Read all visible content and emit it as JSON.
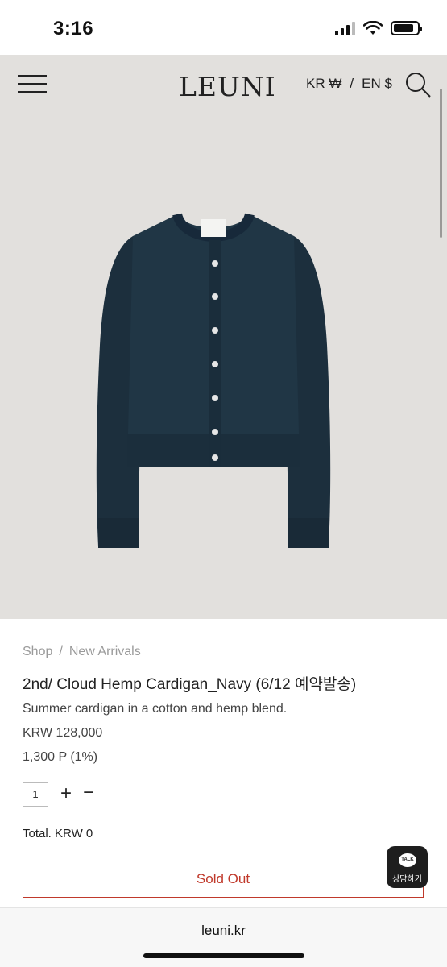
{
  "status": {
    "time": "3:16",
    "battery_level": 0.85
  },
  "header": {
    "logo": "LEUNI",
    "currency_kr": "KR ₩",
    "currency_sep": "/",
    "currency_en": "EN $"
  },
  "breadcrumb": {
    "shop": "Shop",
    "sep": "/",
    "category": "New Arrivals"
  },
  "product": {
    "title": "2nd/ Cloud Hemp Cardigan_Navy (6/12 예약발송)",
    "description": "Summer cardigan in a cotton and hemp blend.",
    "price": "KRW 128,000",
    "points": "1,300 P (1%)",
    "quantity": "1",
    "plus": "+",
    "minus": "−",
    "total": "Total. KRW 0",
    "sold_out": "Sold Out",
    "color": "#1f3443"
  },
  "talk": {
    "bubble": "TALK",
    "label": "상담하기"
  },
  "browser": {
    "url": "leuni.kr"
  }
}
